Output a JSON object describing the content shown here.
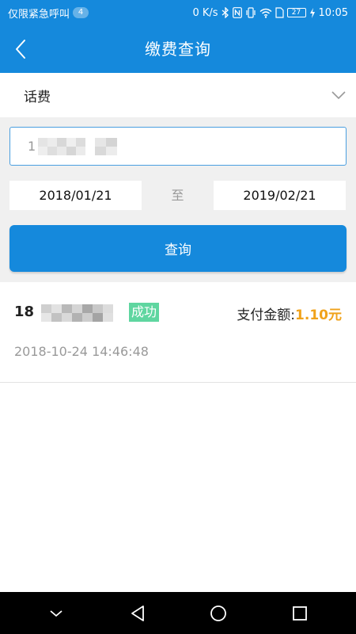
{
  "status_bar": {
    "carrier_text": "仅限紧急呼叫",
    "notification_count": "4",
    "network_speed": "0 K/s",
    "battery_level": "27",
    "time": "10:05"
  },
  "header": {
    "title": "缴费查询"
  },
  "type_select": {
    "selected": "话费"
  },
  "form": {
    "phone_value": "1",
    "phone_placeholder": "",
    "start_date": "2018/01/21",
    "separator": "至",
    "end_date": "2019/02/21",
    "query_button": "查询"
  },
  "results": [
    {
      "phone": "18",
      "status": "成功",
      "amount_label": "支付金额:",
      "amount_value": "1.10元",
      "time": "2018-10-24 14:46:48"
    }
  ],
  "colors": {
    "primary": "#1589dc",
    "success_tag": "#5fd6a0",
    "amount": "#f0a21a"
  }
}
